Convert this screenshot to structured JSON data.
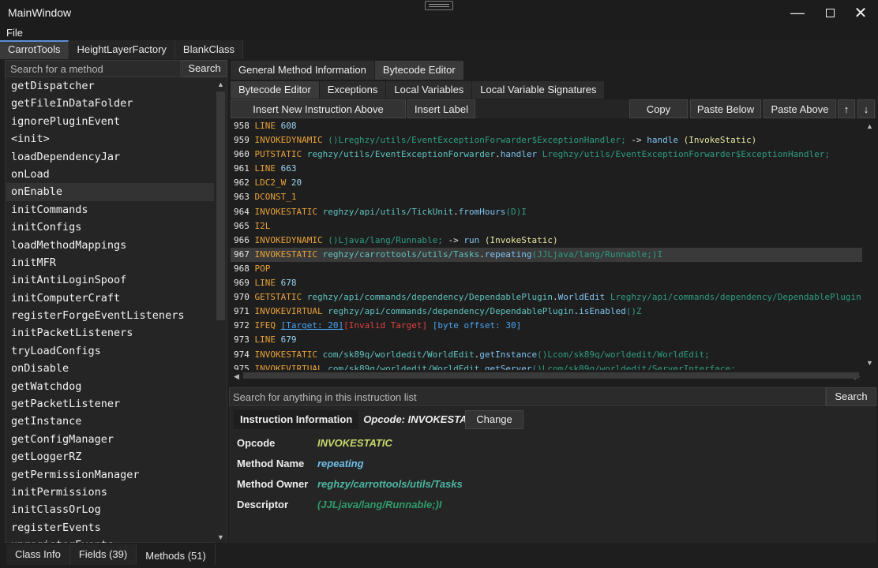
{
  "window": {
    "title": "MainWindow"
  },
  "menu": {
    "file": "File"
  },
  "main_tabs": [
    {
      "label": "CarrotTools",
      "active": true
    },
    {
      "label": "HeightLayerFactory",
      "active": false
    },
    {
      "label": "BlankClass",
      "active": false
    }
  ],
  "left": {
    "search_placeholder": "Search for a method",
    "search_button": "Search",
    "methods": [
      "getDispatcher",
      "getFileInDataFolder",
      "ignorePluginEvent",
      "<init>",
      "loadDependencyJar",
      "onLoad",
      "onEnable",
      "initCommands",
      "initConfigs",
      "loadMethodMappings",
      "initMFR",
      "initAntiLoginSpoof",
      "initComputerCraft",
      "registerForgeEventListeners",
      "initPacketListeners",
      "tryLoadConfigs",
      "onDisable",
      "getWatchdog",
      "getPacketListener",
      "getInstance",
      "getConfigManager",
      "getLoggerRZ",
      "getPermissionManager",
      "initPermissions",
      "initClassOrLog",
      "registerEvents",
      "unregisterEvents"
    ],
    "selected_method": "onEnable"
  },
  "bottom_tabs": [
    {
      "label": "Class Info",
      "active": false
    },
    {
      "label": "Fields (39)",
      "active": false
    },
    {
      "label": "Methods (51)",
      "active": true
    }
  ],
  "right": {
    "tabs": [
      {
        "label": "General Method Information",
        "active": false
      },
      {
        "label": "Bytecode Editor",
        "active": true
      }
    ],
    "subtabs": [
      {
        "label": "Bytecode Editor",
        "active": true
      },
      {
        "label": "Exceptions",
        "active": false
      },
      {
        "label": "Local Variables",
        "active": false
      },
      {
        "label": "Local Variable Signatures",
        "active": false
      }
    ],
    "toolbar": {
      "insert_above": "Insert New Instruction Above Selection",
      "insert_label": "Insert Label",
      "copy": "Copy",
      "paste_below": "Paste Below",
      "paste_above": "Paste Above",
      "move_up": "↑",
      "move_down": "↓"
    },
    "code_lines": [
      {
        "n": "958",
        "parts": [
          [
            "op",
            "LINE"
          ],
          [
            "num",
            " 608"
          ]
        ]
      },
      {
        "n": "959",
        "parts": [
          [
            "op",
            "INVOKEDYNAMIC"
          ],
          [
            "desc",
            " ()Lreghzy/utils/EventExceptionForwarder$ExceptionHandler;"
          ],
          [
            "wht",
            " -> "
          ],
          [
            "mem",
            "handle"
          ],
          [
            "tag",
            " (InvokeStatic)"
          ]
        ]
      },
      {
        "n": "960",
        "parts": [
          [
            "op",
            "PUTSTATIC"
          ],
          [
            "cls",
            " reghzy/utils/EventExceptionForwarder"
          ],
          [
            "wht",
            "."
          ],
          [
            "mem",
            "handler"
          ],
          [
            "desc",
            " Lreghzy/utils/EventExceptionForwarder$ExceptionHandler;"
          ]
        ]
      },
      {
        "n": "961",
        "parts": [
          [
            "op",
            "LINE"
          ],
          [
            "num",
            " 663"
          ]
        ]
      },
      {
        "n": "962",
        "parts": [
          [
            "op",
            "LDC2_W"
          ],
          [
            "num",
            " 20"
          ]
        ]
      },
      {
        "n": "963",
        "parts": [
          [
            "op",
            "DCONST_1"
          ]
        ]
      },
      {
        "n": "964",
        "parts": [
          [
            "op",
            "INVOKESTATIC"
          ],
          [
            "cls",
            " reghzy/api/utils/TickUnit"
          ],
          [
            "wht",
            "."
          ],
          [
            "mem",
            "fromHours"
          ],
          [
            "desc",
            "(D)I"
          ]
        ]
      },
      {
        "n": "965",
        "parts": [
          [
            "op",
            "I2L"
          ]
        ]
      },
      {
        "n": "966",
        "parts": [
          [
            "op",
            "INVOKEDYNAMIC"
          ],
          [
            "desc",
            " ()Ljava/lang/Runnable;"
          ],
          [
            "wht",
            " -> "
          ],
          [
            "mem",
            "run"
          ],
          [
            "tag",
            " (InvokeStatic)"
          ]
        ]
      },
      {
        "n": "967",
        "parts": [
          [
            "op",
            "INVOKESTATIC"
          ],
          [
            "cls",
            " reghzy/carrottools/utils/Tasks"
          ],
          [
            "wht",
            "."
          ],
          [
            "mem",
            "repeating"
          ],
          [
            "desc",
            "(JJLjava/lang/Runnable;)I"
          ]
        ],
        "highlight": true
      },
      {
        "n": "968",
        "parts": [
          [
            "op",
            "POP"
          ]
        ]
      },
      {
        "n": "969",
        "parts": [
          [
            "op",
            "LINE"
          ],
          [
            "num",
            " 678"
          ]
        ]
      },
      {
        "n": "970",
        "parts": [
          [
            "op",
            "GETSTATIC"
          ],
          [
            "cls",
            " reghzy/api/commands/dependency/DependablePlugin"
          ],
          [
            "wht",
            "."
          ],
          [
            "mem",
            "WorldEdit"
          ],
          [
            "desc",
            " Lreghzy/api/commands/dependency/DependablePlugin"
          ]
        ]
      },
      {
        "n": "971",
        "parts": [
          [
            "op",
            "INVOKEVIRTUAL"
          ],
          [
            "cls",
            " reghzy/api/commands/dependency/DependablePlugin"
          ],
          [
            "wht",
            "."
          ],
          [
            "mem",
            "isEnabled"
          ],
          [
            "desc",
            "()Z"
          ]
        ]
      },
      {
        "n": "972",
        "parts": [
          [
            "op",
            "IFEQ"
          ],
          [
            "wht",
            " "
          ],
          [
            "tgt",
            "[Target: 20]"
          ],
          [
            "err",
            "[Invalid Target]"
          ],
          [
            "wht",
            " "
          ],
          [
            "info",
            "[byte offset: 30]"
          ]
        ]
      },
      {
        "n": "973",
        "parts": [
          [
            "op",
            "LINE"
          ],
          [
            "num",
            " 679"
          ]
        ]
      },
      {
        "n": "974",
        "parts": [
          [
            "op",
            "INVOKESTATIC"
          ],
          [
            "cls",
            " com/sk89q/worldedit/WorldEdit"
          ],
          [
            "wht",
            "."
          ],
          [
            "mem",
            "getInstance"
          ],
          [
            "desc",
            "()Lcom/sk89q/worldedit/WorldEdit;"
          ]
        ]
      },
      {
        "n": "975",
        "parts": [
          [
            "op",
            "INVOKEVIRTUAL"
          ],
          [
            "cls",
            " com/sk89q/worldedit/WorldEdit"
          ],
          [
            "wht",
            "."
          ],
          [
            "mem",
            "getServer"
          ],
          [
            "desc",
            "()Lcom/sk89q/worldedit/ServerInterface;"
          ]
        ]
      }
    ],
    "instruction_search_placeholder": "Search for anything in this instruction list",
    "instruction_search_button": "Search",
    "info": {
      "header": "Instruction Information",
      "opcode_header": "Opcode: INVOKESTATIC",
      "change_button": "Change",
      "rows": [
        {
          "label": "Opcode",
          "value": "INVOKESTATIC",
          "cls": "c-op"
        },
        {
          "label": "Method Name",
          "value": "repeating",
          "cls": "c-mem"
        },
        {
          "label": "Method Owner",
          "value": "reghzy/carrottools/utils/Tasks",
          "cls": "c-cls"
        },
        {
          "label": "Descriptor",
          "value": "(JJLjava/lang/Runnable;)I",
          "cls": "c-desc"
        }
      ]
    }
  }
}
